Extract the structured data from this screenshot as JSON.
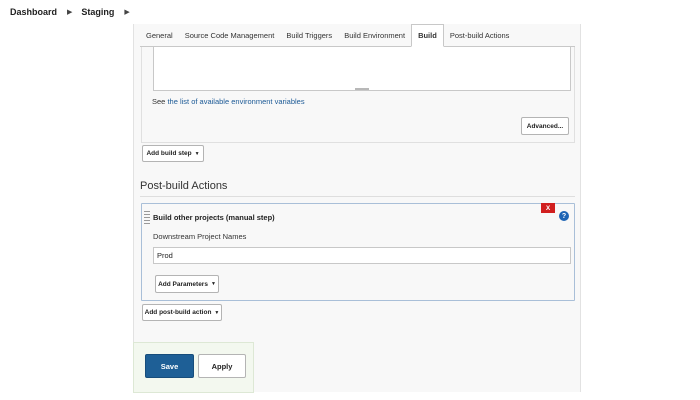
{
  "breadcrumb": {
    "items": [
      "Dashboard",
      "Staging"
    ],
    "separator_icon": "chevron-right-icon"
  },
  "tabs": [
    {
      "label": "General",
      "active": false
    },
    {
      "label": "Source Code Management",
      "active": false
    },
    {
      "label": "Build Triggers",
      "active": false
    },
    {
      "label": "Build Environment",
      "active": false
    },
    {
      "label": "Build",
      "active": true
    },
    {
      "label": "Post-build Actions",
      "active": false
    }
  ],
  "build": {
    "command_value": "",
    "env_prefix": "See ",
    "env_link": "the list of available environment variables",
    "advanced_label": "Advanced...",
    "add_build_step_label": "Add build step"
  },
  "post_build": {
    "section_title": "Post-build Actions",
    "step_title": "Build other projects (manual step)",
    "delete_label": "X",
    "help_label": "?",
    "field_label": "Downstream Project Names",
    "field_value": "Prod",
    "add_parameters_label": "Add Parameters",
    "add_action_label": "Add post-build action"
  },
  "footer": {
    "save_label": "Save",
    "apply_label": "Apply"
  },
  "colors": {
    "primary": "#1e5f96",
    "link": "#1c5a96",
    "danger": "#d11f1f",
    "help": "#1e64b4",
    "save_bar_bg": "#f3f8ef"
  }
}
